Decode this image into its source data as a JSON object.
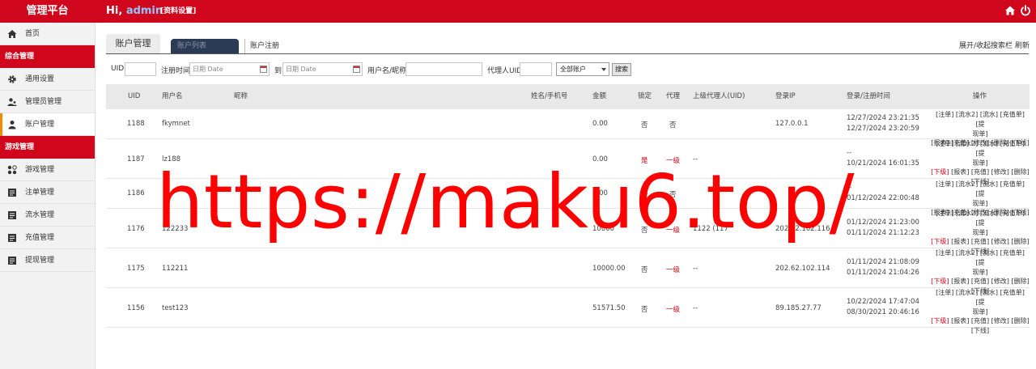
{
  "app": {
    "brand": "管理平台",
    "greeting": "Hi,",
    "username": "admin",
    "profile_link": "[资料设置]"
  },
  "sidebar": {
    "home": "首页",
    "section1": "综合管理",
    "general_settings": "通用设置",
    "admin_manage": "管理员管理",
    "account_manage": "账户管理",
    "section2": "游戏管理",
    "game_manage": "游戏管理",
    "bet_manage": "注单管理",
    "flow_manage": "流水管理",
    "recharge_manage": "充值管理",
    "withdraw_manage": "提现管理"
  },
  "tabs": {
    "main": "账户管理",
    "list": "账户列表",
    "register": "账户注册",
    "toggle_search": "展开/收起搜索栏",
    "refresh": "刷新"
  },
  "filters": {
    "uid_label": "UID",
    "uid_value": "",
    "reg_time_label": "注册时间",
    "date_placeholder": "日期 Date",
    "to_label": "到",
    "name_label": "用户名/昵称",
    "name_value": "",
    "agent_label": "代理人UID",
    "agent_value": "",
    "account_select": "全部账户",
    "search_button": "搜索"
  },
  "table": {
    "headers": {
      "uid": "UID",
      "username": "用户名",
      "nickname": "昵称",
      "name_phone": "姓名/手机号",
      "amount": "金额",
      "locked": "锁定",
      "agent": "代理",
      "parent_agent": "上级代理人(UID)",
      "login_ip": "登录IP",
      "login_reg_time": "登录/注册时间",
      "actions": "操作"
    },
    "rows": [
      {
        "uid": "1188",
        "username": "fkymnet",
        "amount": "0.00",
        "locked": "否",
        "agent": "否",
        "parent": "",
        "ip": "127.0.0.1",
        "login_time": "12/27/2024 23:21:35",
        "reg_time": "12/27/2024 23:20:59"
      },
      {
        "uid": "1187",
        "username": "lz188",
        "amount": "0.00",
        "locked": "是",
        "agent": "一级",
        "parent": "--",
        "ip": "",
        "login_time": "--",
        "reg_time": "10/21/2024 16:01:35"
      },
      {
        "uid": "1186",
        "username": "",
        "amount": "0.00",
        "locked": "否",
        "agent": "否",
        "parent": "",
        "ip": "",
        "login_time": "--",
        "reg_time": "01/12/2024 22:00:48"
      },
      {
        "uid": "1176",
        "username": "122233",
        "amount": "10000",
        "locked": "否",
        "agent": "一级",
        "parent": "1122 (117",
        "ip": "202.62.102.116",
        "login_time": "01/12/2024 21:23:00",
        "reg_time": "01/11/2024 21:12:23"
      },
      {
        "uid": "1175",
        "username": "112211",
        "amount": "10000.00",
        "locked": "否",
        "agent": "一级",
        "parent": "--",
        "ip": "202.62.102.114",
        "login_time": "01/11/2024 21:08:09",
        "reg_time": "01/11/2024 21:04:26"
      },
      {
        "uid": "1156",
        "username": "test123",
        "amount": "51571.50",
        "locked": "否",
        "agent": "一级",
        "parent": "--",
        "ip": "89.185.27.77",
        "login_time": "10/22/2024 17:47:04",
        "reg_time": "08/30/2021 20:46:16"
      }
    ],
    "ops": {
      "bet": "[注单]",
      "flow2": "[流水2]",
      "flow": "[流水]",
      "recharge": "[充值单]",
      "withdraw_a": "[提",
      "withdraw_b": "现单]",
      "sub": "[下级]",
      "report": "[报表]",
      "charge": "[充值]",
      "modify": "[修改]",
      "delete": "[删除]",
      "offline": "[下线]"
    }
  },
  "watermark": "https://maku6.top/",
  "colors": {
    "brand_red": "#d0071c",
    "sidebar_bg": "#f2f2f2",
    "active_marker": "#f08b00",
    "username_blue": "#8fc5ff"
  }
}
